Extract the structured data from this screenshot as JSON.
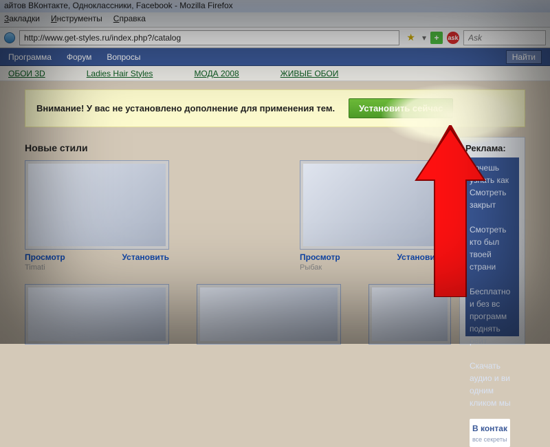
{
  "window": {
    "title": "айтов ВКонтакте, Одноклассники, Facebook - Mozilla Firefox"
  },
  "menu": {
    "bookmarks": "Закладки",
    "tools": "Инструменты",
    "help": "Справка"
  },
  "address": {
    "url": "http://www.get-styles.ru/index.php?/catalog",
    "ask_placeholder": "Ask"
  },
  "nav": {
    "program": "Программа",
    "forum": "Форум",
    "questions": "Вопросы",
    "find": "Найти"
  },
  "links": {
    "wallpaper3d": "ОБОИ 3D",
    "ladies": "Ladies Hair Styles",
    "moda": "МОДА 2008",
    "live": "ЖИВЫЕ ОБОИ"
  },
  "alert": {
    "text": "Внимание! У вас не установлено дополнение для применения тем.",
    "button": "Установить сейчас"
  },
  "section": {
    "new_styles": "Новые стили"
  },
  "actions": {
    "view": "Просмотр",
    "install": "Установить"
  },
  "cards": [
    {
      "title": "Timati"
    },
    {
      "title": "Рыбак"
    }
  ],
  "sidebar": {
    "title": "Реклама:",
    "ad_lines": "Хочешь узнать как\nСмотреть закрыт\n\nСмотреть кто был\nтвоей страни\n\nБесплатно и без вс\nпрограмм поднять\nрейт\n\nСкачать аудио и ви\nодним кликом мы",
    "vk": "В контак",
    "vk_sub": "все секреты"
  }
}
